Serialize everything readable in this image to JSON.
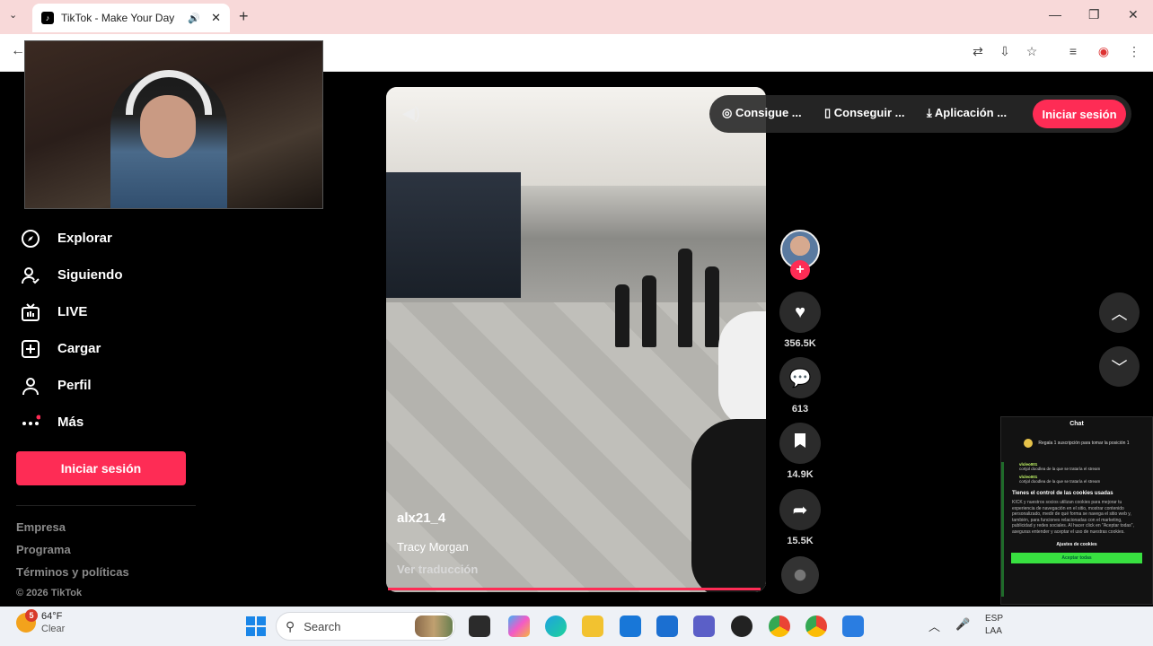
{
  "browser": {
    "tab_title": "TikTok - Make Your Day",
    "tab_close": "✕",
    "new_tab": "+",
    "dropdown": "⌄",
    "window_controls": [
      "—",
      "❐",
      "✕"
    ]
  },
  "sidebar": {
    "items": [
      {
        "label": "Explorar",
        "icon": "compass-icon"
      },
      {
        "label": "Siguiendo",
        "icon": "following-icon"
      },
      {
        "label": "LIVE",
        "icon": "live-tv-icon"
      },
      {
        "label": "Cargar",
        "icon": "upload-icon"
      },
      {
        "label": "Perfil",
        "icon": "profile-icon"
      },
      {
        "label": "Más",
        "icon": "more-icon"
      }
    ],
    "login_label": "Iniciar sesión",
    "footer": [
      "Empresa",
      "Programa",
      "Términos y políticas"
    ],
    "copyright": "© 2026 TikTok"
  },
  "topbar": {
    "items": [
      "Consigue ...",
      "Conseguir ...",
      "Aplicación ..."
    ],
    "login_label": "Iniciar sesión"
  },
  "video": {
    "author": "alx21_4",
    "description": "Tracy Morgan",
    "translate": "Ver traducción",
    "progress": 0.98
  },
  "actions": {
    "likes": "356.5K",
    "comments": "613",
    "saves": "14.9K",
    "shares": "15.5K"
  },
  "chat": {
    "title": "Chat",
    "rule": "Regala 1 suscripción para tomar la posición 1",
    "messages": [
      {
        "user": "vlcleo001",
        "text": "cortjol doodlea de la que se trataría el stream"
      },
      {
        "user": "vlcleo001",
        "text": "cortjol doodlea de la que se trataría el stream"
      }
    ],
    "cookie_title": "Tienes el control de las cookies usadas",
    "cookie_text": "KICK y nuestros socios utilizan cookies para mejorar tu experiencia de navegación en el sitio, mostrar contenido personalizado, medir de qué forma se navega el sitio web y, también, para funciones relacionadas con el marketing, publicidad y redes sociales. Al hacer click en \"Aceptar todas\", aseguras entender y aceptar el uso de nuestras cookies.",
    "cookie_settings": "Ajustes de cookies",
    "cookie_accept": "Aceptar todas"
  },
  "taskbar": {
    "temperature": "64°F",
    "condition": "Clear",
    "weather_badge": "5",
    "search_placeholder": "Search",
    "tray_lang": "ESP",
    "tray_layout": "LAA"
  }
}
